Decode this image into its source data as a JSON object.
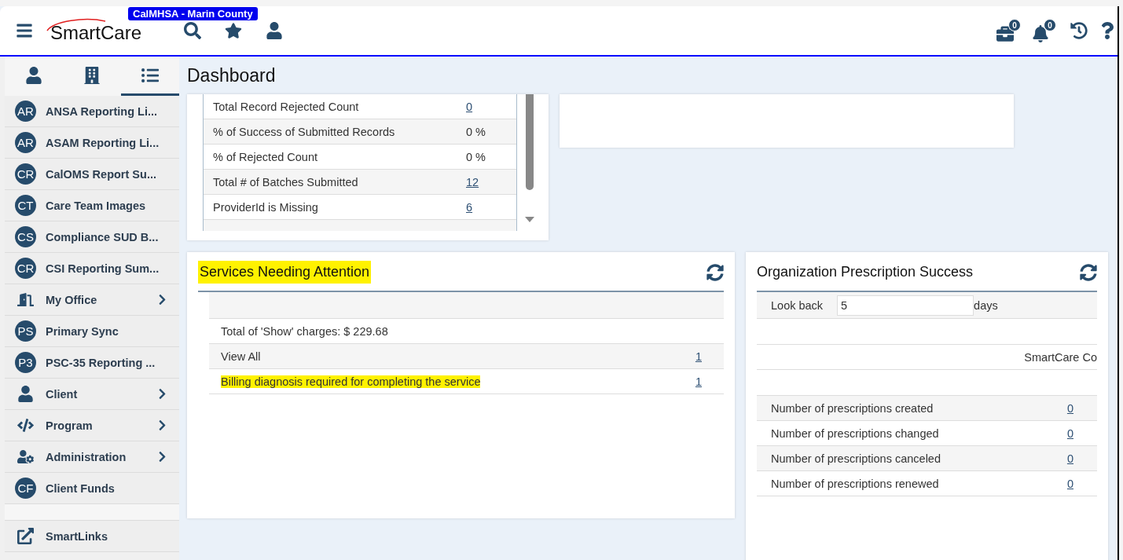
{
  "header": {
    "org_badge": "CalMHSA - Marin County",
    "logo": "SmartCare",
    "counters": [
      {
        "kind": "briefcase",
        "count": "0"
      },
      {
        "kind": "bell",
        "count": "0"
      }
    ]
  },
  "sidebar": {
    "tabs": [
      {
        "kind": "person",
        "selected": false
      },
      {
        "kind": "building",
        "selected": false
      },
      {
        "kind": "list",
        "selected": true
      }
    ],
    "items": [
      {
        "kind": "initials",
        "initials": "AR",
        "label": "ANSA Reporting Li...",
        "expandable": false
      },
      {
        "kind": "initials",
        "initials": "AR",
        "label": "ASAM Reporting Li...",
        "expandable": false
      },
      {
        "kind": "initials",
        "initials": "CR",
        "label": "CalOMS Report Su...",
        "expandable": false
      },
      {
        "kind": "initials",
        "initials": "CT",
        "label": "Care Team Images",
        "expandable": false
      },
      {
        "kind": "initials",
        "initials": "CS",
        "label": "Compliance SUD B...",
        "expandable": false
      },
      {
        "kind": "initials",
        "initials": "CR",
        "label": "CSI Reporting Sum...",
        "expandable": false
      },
      {
        "kind": "office",
        "label": "My Office",
        "expandable": true
      },
      {
        "kind": "initials",
        "initials": "PS",
        "label": "Primary Sync",
        "expandable": false
      },
      {
        "kind": "initials",
        "initials": "P3",
        "label": "PSC-35 Reporting ...",
        "expandable": false
      },
      {
        "kind": "person",
        "label": "Client",
        "expandable": true
      },
      {
        "kind": "code",
        "label": "Program",
        "expandable": true
      },
      {
        "kind": "admin",
        "label": "Administration",
        "expandable": true
      },
      {
        "kind": "initials",
        "initials": "CF",
        "label": "Client Funds",
        "expandable": false
      }
    ],
    "footer": {
      "label": "SmartLinks"
    }
  },
  "page_title": "Dashboard",
  "submission_widget": {
    "rows": [
      {
        "label": "Total Record Rejected Count",
        "value": "0",
        "linked": true
      },
      {
        "label": "% of Success of Submitted Records",
        "value": "0 %",
        "linked": false
      },
      {
        "label": "% of Rejected Count",
        "value": "0 %",
        "linked": false
      },
      {
        "label": "Total # of Batches Submitted",
        "value": "12",
        "linked": true
      },
      {
        "label": "ProviderId is Missing",
        "value": "6",
        "linked": true
      }
    ]
  },
  "services_widget": {
    "title": "Services Needing Attention",
    "title_highlighted": true,
    "rows": [
      {
        "label": "Total of 'Show' charges: $ 229.68",
        "highlighted": false
      },
      {
        "label": "View All",
        "count": "1",
        "highlighted": false
      },
      {
        "label": "Billing diagnosis required for completing the service",
        "count": "1",
        "highlighted": true
      }
    ]
  },
  "prescription_widget": {
    "title": "Organization Prescription Success",
    "look_back_label": "Look back",
    "look_back_value": "5",
    "look_back_unit": "days",
    "column_header": "SmartCare Co",
    "rows": [
      {
        "label": "Number of prescriptions created",
        "value": "0"
      },
      {
        "label": "Number of prescriptions changed",
        "value": "0"
      },
      {
        "label": "Number of prescriptions canceled",
        "value": "0"
      },
      {
        "label": "Number of prescriptions renewed",
        "value": "0"
      }
    ]
  }
}
